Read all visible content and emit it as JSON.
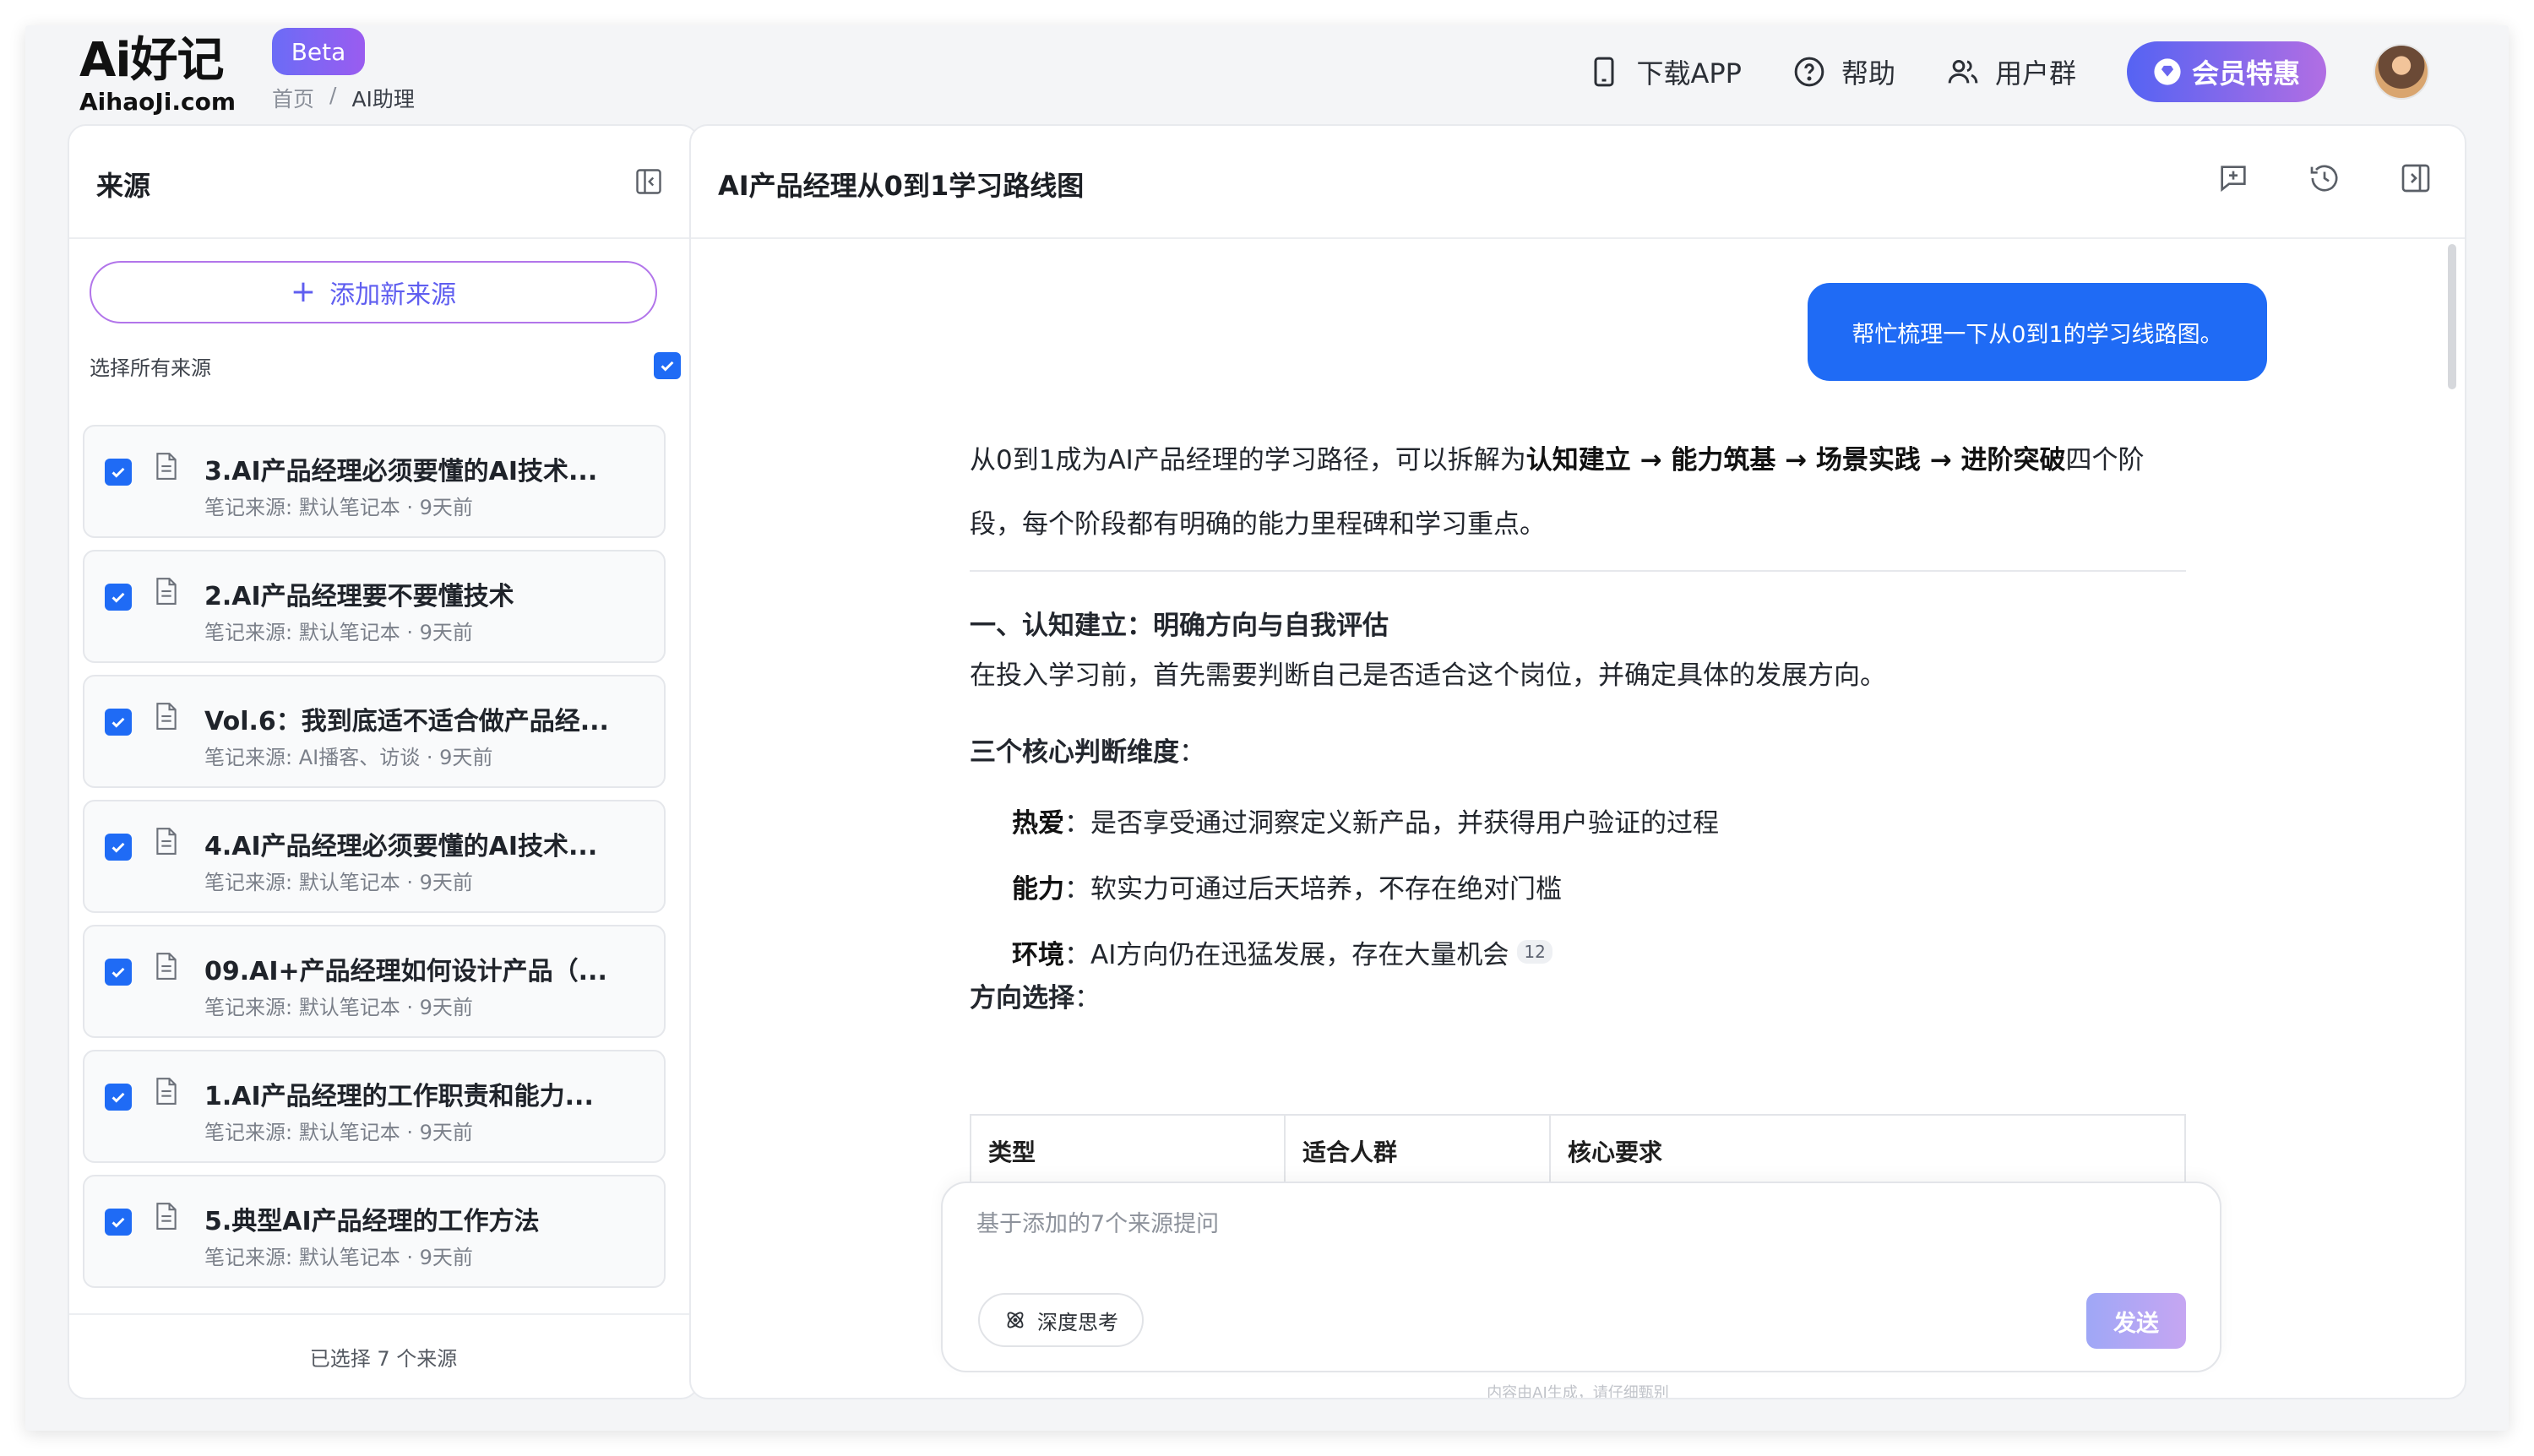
{
  "header": {
    "logo_mark": "Ai好记",
    "logo_sub": "AihaoJi.com",
    "beta": "Beta",
    "breadcrumb": [
      "首页",
      "/",
      "AI助理"
    ],
    "nav": {
      "download": "下载APP",
      "help": "帮助",
      "group": "用户群",
      "vip": "会员特惠"
    }
  },
  "sources": {
    "title": "来源",
    "add_button": "添加新来源",
    "select_all": "选择所有来源",
    "items": [
      {
        "title": "3.AI产品经理必须要懂的AI技术...",
        "meta": "笔记来源: 默认笔记本 · 9天前"
      },
      {
        "title": "2.AI产品经理要不要懂技术",
        "meta": "笔记来源: 默认笔记本 · 9天前"
      },
      {
        "title": "Vol.6：我到底适不适合做产品经...",
        "meta": "笔记来源: AI播客、访谈 · 9天前"
      },
      {
        "title": "4.AI产品经理必须要懂的AI技术...",
        "meta": "笔记来源: 默认笔记本 · 9天前"
      },
      {
        "title": "09.AI+产品经理如何设计产品（...",
        "meta": "笔记来源: 默认笔记本 · 9天前"
      },
      {
        "title": "1.AI产品经理的工作职责和能力...",
        "meta": "笔记来源: 默认笔记本 · 9天前"
      },
      {
        "title": "5.典型AI产品经理的工作方法",
        "meta": "笔记来源: 默认笔记本 · 9天前"
      }
    ],
    "footer": "已选择 7 个来源"
  },
  "chat": {
    "title": "AI产品经理从0到1学习路线图",
    "user_message": "帮忙梳理一下从0到1的学习线路图。",
    "answer": {
      "intro_before": "从0到1成为AI产品经理的学习路径，可以拆解为",
      "intro_bold": "认知建立 → 能力筑基 → 场景实践 → 进阶突破",
      "intro_after": "四个阶段，每个阶段都有明确的能力里程碑和学习重点。",
      "section1_title": "一、认知建立：明确方向与自我评估",
      "section1_text": "在投入学习前，首先需要判断自己是否适合这个岗位，并确定具体的发展方向。",
      "dims_title": "三个核心判断维度",
      "dims_colon": "：",
      "dims": [
        {
          "label": "热爱",
          "text": "：是否享受通过洞察定义新产品，并获得用户验证的过程"
        },
        {
          "label": "能力",
          "text": "：软实力可通过后天培养，不存在绝对门槛"
        },
        {
          "label": "环境",
          "text": "：AI方向仍在迅猛发展，存在大量机会",
          "ref": "12"
        }
      ],
      "direction_title": "方向选择",
      "direction_colon": "：",
      "table_headers": [
        "类型",
        "适合人群",
        "核心要求"
      ]
    },
    "input_placeholder": "基于添加的7个来源提问",
    "deep_think": "深度思考",
    "send": "发送",
    "disclaimer": "内容由AI生成，请仔细甄别"
  },
  "colors": {
    "accent": "#1f6bf5",
    "brand_gradient_start": "#5563f3",
    "brand_gradient_end": "#b16ee3"
  }
}
